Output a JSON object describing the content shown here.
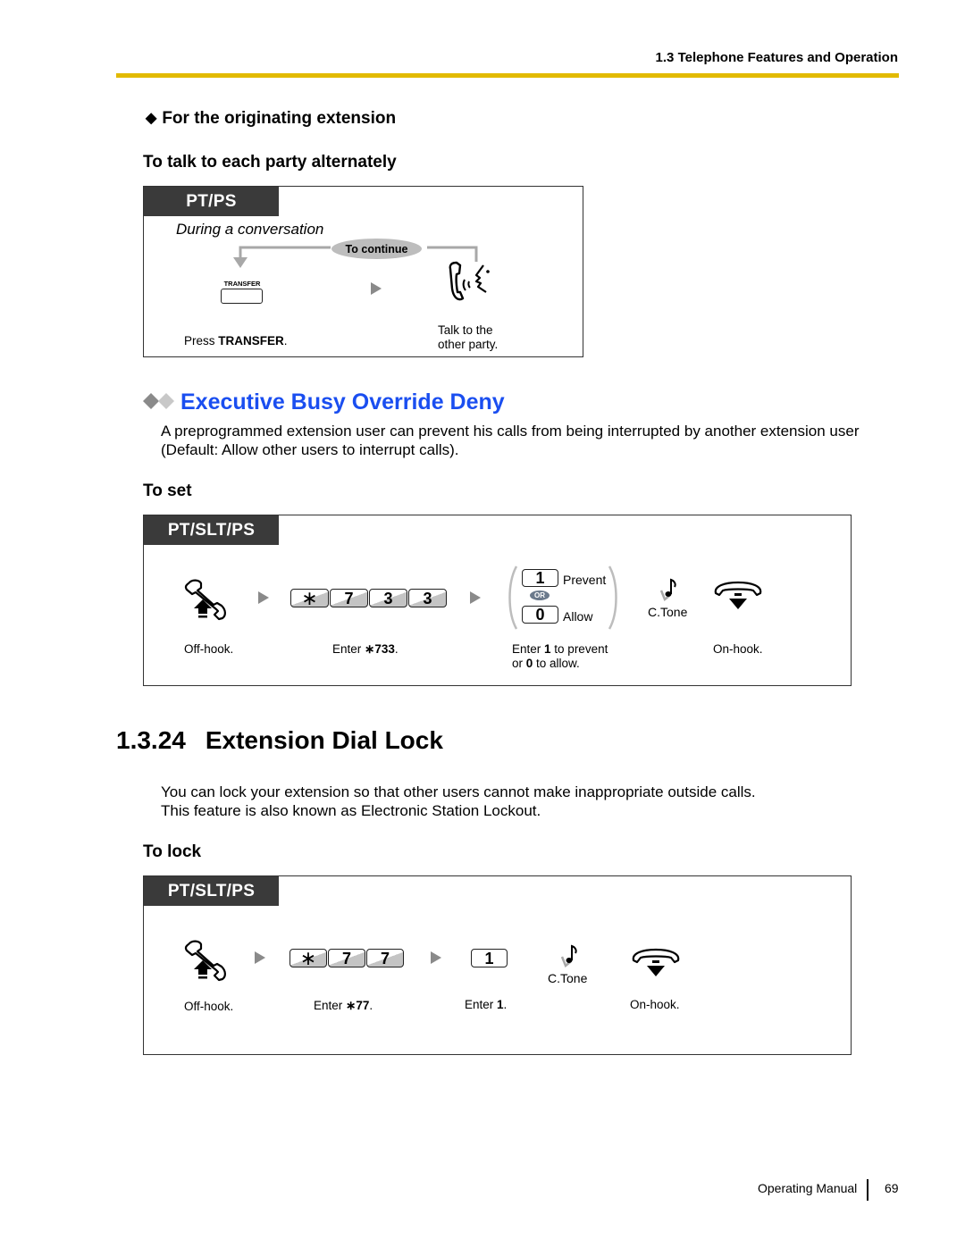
{
  "header": {
    "running_head": "1.3 Telephone Features and Operation",
    "rule_color": "#e2ba00"
  },
  "originating": {
    "heading": "For the originating extension",
    "subheading": "To talk to each party alternately",
    "box": {
      "tab_label": "PT/PS",
      "context": "During a conversation",
      "loop_label": "To continue",
      "transfer_key_label": "TRANSFER",
      "step1_prefix": "Press ",
      "step1_bold": "TRANSFER",
      "step1_suffix": ".",
      "step2_line1": "Talk to the",
      "step2_line2": "other party."
    }
  },
  "executive": {
    "title": "Executive Busy Override Deny",
    "title_color": "#1a4ef0",
    "desc_line1": "A preprogrammed extension user can prevent his calls from being interrupted by another extension user",
    "desc_line2": "(Default: Allow other users to interrupt calls).",
    "procedure_heading": "To set",
    "box": {
      "tab_label": "PT/SLT/PS",
      "keys": [
        "∗",
        "7",
        "3",
        "3"
      ],
      "choice_keys": [
        {
          "key": "1",
          "label": "Prevent"
        },
        {
          "key": "0",
          "label": "Allow"
        }
      ],
      "or_label": "OR",
      "tone_label": "C.Tone",
      "cap_offhook": "Off-hook.",
      "cap_enter_prefix": "Enter ",
      "cap_enter_code": "∗733",
      "cap_enter_suffix": ".",
      "cap_choice_a": "Enter ",
      "cap_choice_b": "1",
      "cap_choice_c": " to prevent",
      "cap_choice_d": "or ",
      "cap_choice_e": "0",
      "cap_choice_f": " to allow.",
      "cap_onhook": "On-hook."
    }
  },
  "dial_lock": {
    "number": "1.3.24",
    "title": "Extension Dial Lock",
    "desc_line1": "You can lock your extension so that other users cannot make inappropriate outside calls.",
    "desc_line2": "This feature is also known as Electronic Station Lockout.",
    "procedure_heading": "To lock",
    "box": {
      "tab_label": "PT/SLT/PS",
      "keys": [
        "∗",
        "7",
        "7"
      ],
      "key_single": "1",
      "tone_label": "C.Tone",
      "cap_offhook": "Off-hook.",
      "cap_enter_prefix": "Enter ",
      "cap_enter_code": "∗77",
      "cap_enter_suffix": ".",
      "cap_enter1_prefix": "Enter ",
      "cap_enter1_code": "1",
      "cap_enter1_suffix": ".",
      "cap_onhook": "On-hook."
    }
  },
  "footer": {
    "label": "Operating Manual",
    "page": "69"
  }
}
